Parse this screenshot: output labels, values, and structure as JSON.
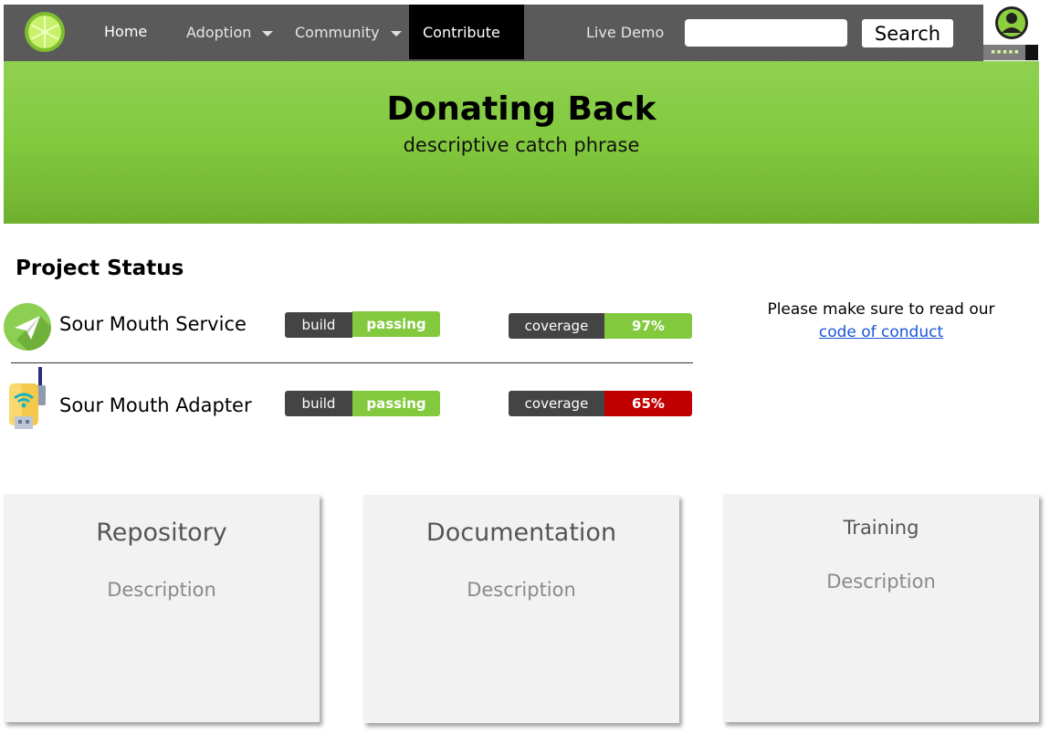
{
  "nav": {
    "home": "Home",
    "adoption": "Adoption",
    "community": "Community",
    "contribute": "Contribute",
    "live_demo": "Live Demo",
    "search_placeholder": "",
    "search_button": "Search",
    "logo_icon": "lime-logo-icon",
    "avatar_icon": "user-avatar-icon"
  },
  "hero": {
    "title": "Donating Back",
    "subtitle": "descriptive catch phrase"
  },
  "status": {
    "title": "Project Status",
    "projects": [
      {
        "name": "Sour Mouth Service",
        "icon": "paper-plane-icon",
        "build_label": "build",
        "build_value": "passing",
        "coverage_label": "coverage",
        "coverage_value": "97%",
        "coverage_color": "#82c93e"
      },
      {
        "name": "Sour Mouth Adapter",
        "icon": "wifi-adapter-icon",
        "build_label": "build",
        "build_value": "passing",
        "coverage_label": "coverage",
        "coverage_value": "65%",
        "coverage_color": "#c00000"
      }
    ],
    "conduct_text": "Please make sure to read our",
    "conduct_link": "code of conduct"
  },
  "cards": [
    {
      "title": "Repository",
      "description": "Description"
    },
    {
      "title": "Documentation",
      "description": "Description"
    },
    {
      "title": "Training",
      "description": "Description"
    }
  ],
  "colors": {
    "nav_bg": "#5a5a5a",
    "accent_green": "#82c93e",
    "active_tab": "#000000",
    "badge_dark": "#444444",
    "coverage_low": "#c00000"
  }
}
